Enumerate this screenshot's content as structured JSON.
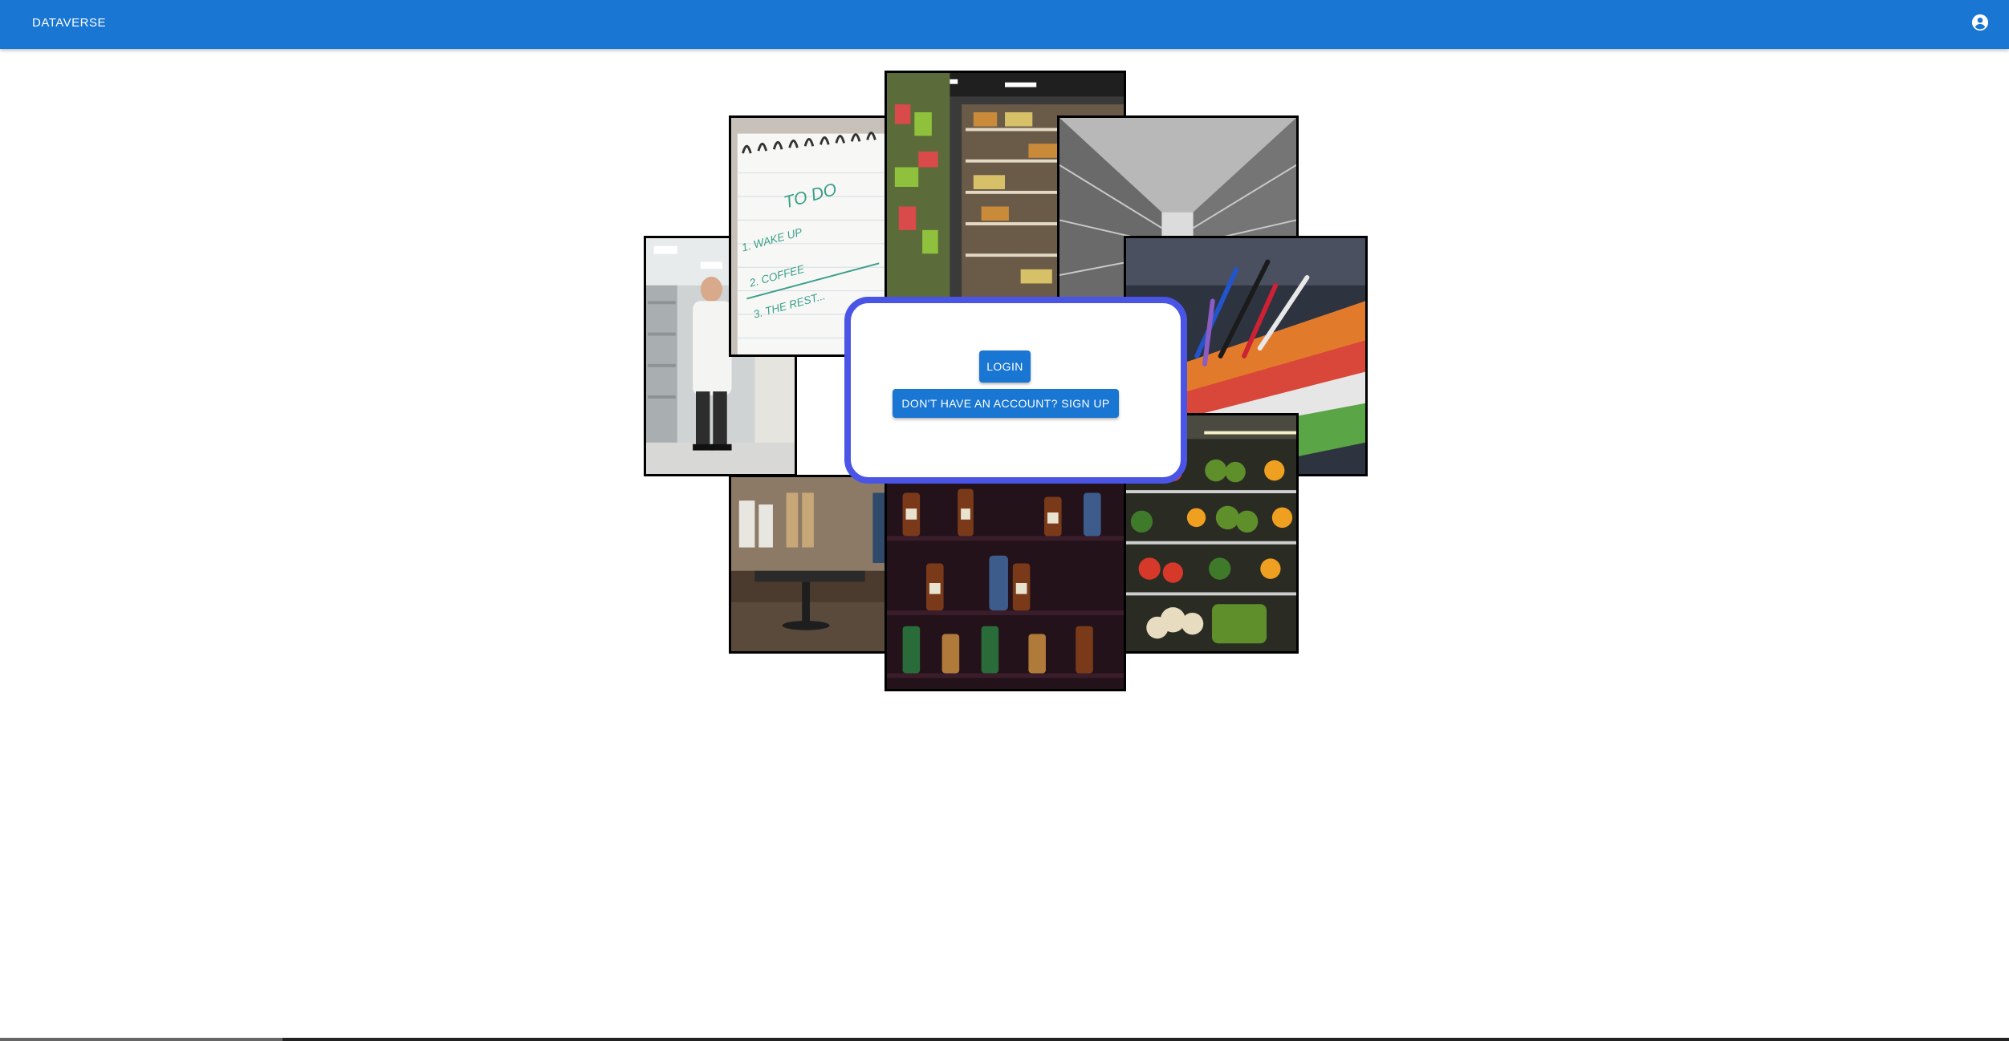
{
  "appbar": {
    "brand": "DATAVERSE",
    "account_icon": "account-circle-icon",
    "color": "#1976d2"
  },
  "collage": {
    "tiles": [
      {
        "name": "pharmacist-photo",
        "subject": "pharmacist in pharmacy aisle"
      },
      {
        "name": "todo-notebook-photo",
        "subject": "notebook",
        "text": [
          "TO DO",
          "1. WAKE UP",
          "2. COFFEE",
          "3. THE REST..."
        ]
      },
      {
        "name": "supermarket-aisle-photo",
        "subject": "supermarket snack aisle"
      },
      {
        "name": "warehouse-photo",
        "subject": "warehouse shelving"
      },
      {
        "name": "stationery-photo",
        "subject": "pens and folders"
      },
      {
        "name": "clothing-store-photo",
        "subject": "clothing boutique"
      },
      {
        "name": "liquor-shelf-photo",
        "subject": "liquor bottles on shelf"
      },
      {
        "name": "produce-display-photo",
        "subject": "fruit and vegetable display"
      }
    ]
  },
  "auth_card": {
    "border_color": "#4a55e6",
    "login_label": "LOGIN",
    "signup_label": "DON'T HAVE AN ACCOUNT? SIGN UP"
  }
}
